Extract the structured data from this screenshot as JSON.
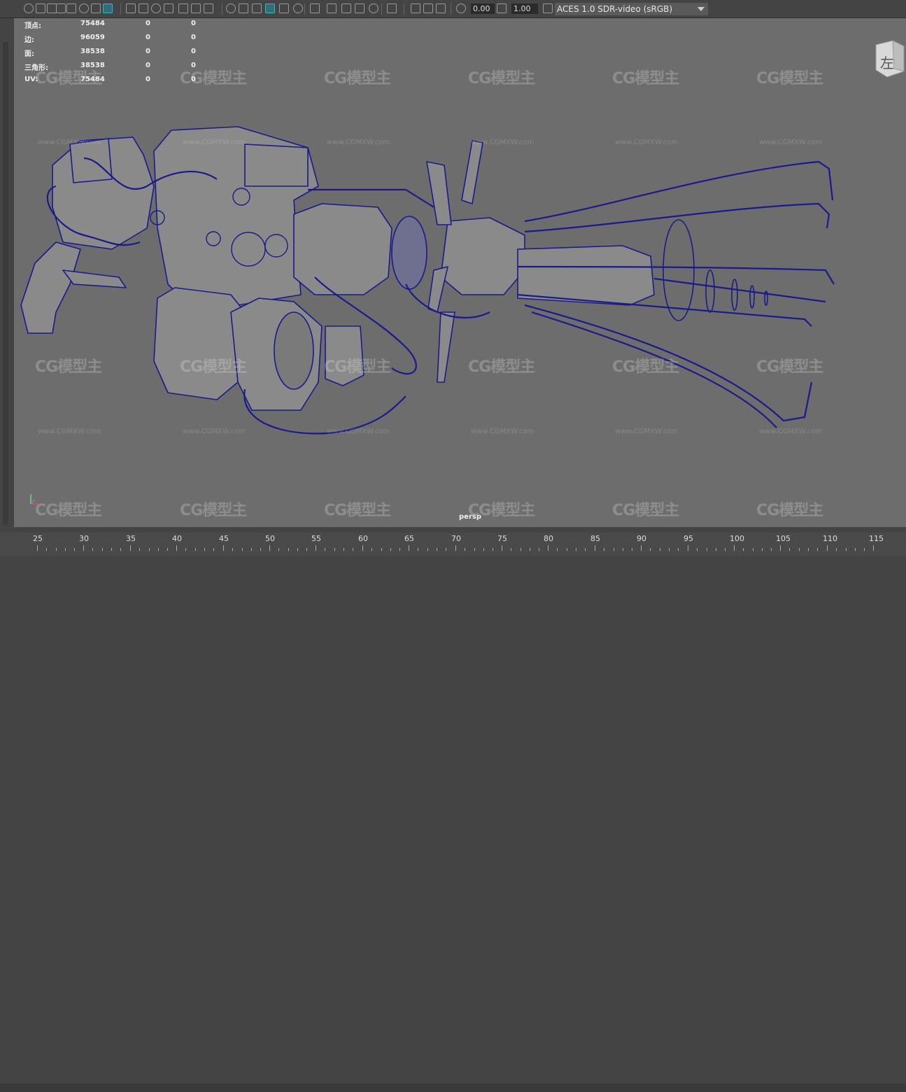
{
  "toolbar": {
    "icons": [
      "camera-icon",
      "camera-attributes-icon",
      "bookmark-icon",
      "image-plane-icon",
      "grid-icon",
      "film-gate-icon",
      "resolution-gate-icon",
      "gate-mask-icon",
      "field-chart-icon",
      "safe-action-icon",
      "safe-title-icon",
      "wireframe-icon",
      "smooth-shade-icon",
      "wireframe-on-shaded-icon",
      "textured-icon",
      "lighting-icon",
      "shadows-icon",
      "ambient-occlusion-icon",
      "motion-blur-icon",
      "antialias-icon",
      "depth-of-field-icon",
      "isolate-select-icon",
      "xray-icon",
      "xray-joints-icon",
      "backface-icon",
      "exposure-icon",
      "gamma-icon",
      "color-management-icon"
    ],
    "exposure_value": "0.00",
    "gamma_value": "1.00",
    "color_space": "ACES 1.0 SDR-video (sRGB)"
  },
  "hud": {
    "rows": [
      {
        "label": "顶点:",
        "v1": "75484",
        "v2": "0",
        "v3": "0"
      },
      {
        "label": "边:",
        "v1": "96059",
        "v2": "0",
        "v3": "0"
      },
      {
        "label": "面:",
        "v1": "38538",
        "v2": "0",
        "v3": "0"
      },
      {
        "label": "三角形:",
        "v1": "38538",
        "v2": "0",
        "v3": "0"
      },
      {
        "label": "UV:",
        "v1": "75484",
        "v2": "0",
        "v3": "0"
      }
    ]
  },
  "viewcube_label": "左",
  "camera_label": "persp",
  "watermark": {
    "logo": "CG模型主",
    "url": "www.CGMXW.com"
  },
  "timeline": {
    "ticks": [
      "25",
      "30",
      "35",
      "40",
      "45",
      "50",
      "55",
      "60",
      "65",
      "70",
      "75",
      "80",
      "85",
      "90",
      "95",
      "100",
      "105",
      "110",
      "115"
    ]
  },
  "colors": {
    "viewport_bg": "#6d6d6d",
    "wire": "#1a1a8a",
    "panel": "#444444",
    "active_icon": "#3ab4c8"
  }
}
